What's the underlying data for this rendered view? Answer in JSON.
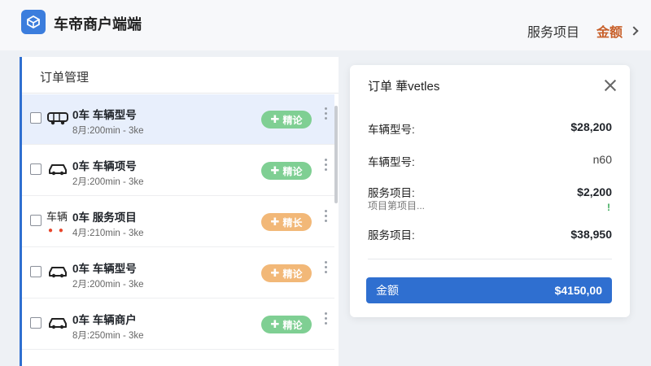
{
  "app": {
    "title": "车帝商户端端"
  },
  "nav": {
    "services": "服务项目",
    "amount": "金额"
  },
  "orders_panel": {
    "title": "订单管理",
    "rows": [
      {
        "title": "0车 车辆型号",
        "sub": "8月:200min - 3ke",
        "action": "精论",
        "action_color": "green",
        "selected": true
      },
      {
        "title": "0车 车辆项号",
        "sub": "2月:200min - 3ke",
        "action": "精论",
        "action_color": "green",
        "selected": false
      },
      {
        "type_label": "车辆",
        "title": "0车 服务项目",
        "sub": "4月:210min - 3ke",
        "action": "精长",
        "action_color": "orange",
        "selected": false
      },
      {
        "title": "0车 车辆型号",
        "sub": "2月:200min - 3ke",
        "action": "精论",
        "action_color": "orange",
        "selected": false
      },
      {
        "title": "0车 车辆商户",
        "sub": "8月:250min - 3ke",
        "action": "精论",
        "action_color": "green",
        "selected": false
      }
    ]
  },
  "detail": {
    "title": "订单 華vetles",
    "items": [
      {
        "label": "车辆型号:",
        "value": "$28,200"
      },
      {
        "label": "车辆型号:",
        "value": "n60"
      },
      {
        "label": "服务项目:",
        "sub": "项目第项目...",
        "value": "$2,200",
        "mark": "!"
      },
      {
        "label": "服务项目:",
        "value": "$38,950"
      }
    ],
    "total_label": "金额",
    "total_value": "$4150,00"
  },
  "colors": {
    "accent": "#2f6fd0",
    "green_pill": "#7fcf93",
    "orange_pill": "#f2b878",
    "amount_nav": "#c8602a"
  }
}
